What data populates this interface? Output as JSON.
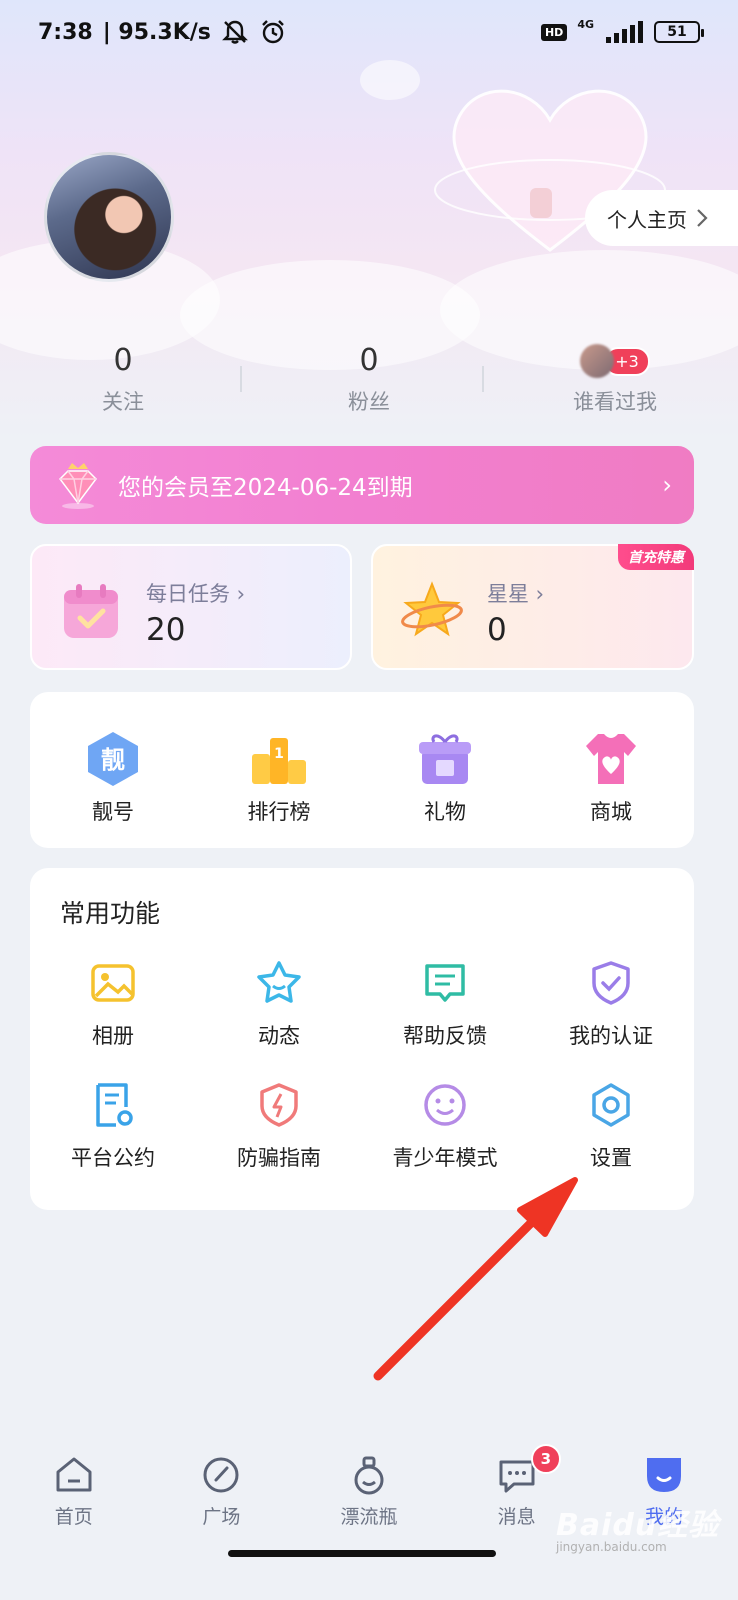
{
  "status_bar": {
    "time": "7:38",
    "speed": "| 95.3K/s",
    "network": "4G",
    "hd": "HD",
    "battery": "51"
  },
  "profile": {
    "homepage_label": "个人主页",
    "stats": [
      {
        "value": "0",
        "label": "关注"
      },
      {
        "value": "0",
        "label": "粉丝"
      },
      {
        "label": "谁看过我",
        "badge": "+3"
      }
    ]
  },
  "vip": {
    "text": "您的会员至2024-06-24到期"
  },
  "cards": {
    "task": {
      "title": "每日任务 ›",
      "value": "20"
    },
    "star": {
      "title": "星星 ›",
      "value": "0",
      "tag": "首充特惠"
    }
  },
  "quick": {
    "items": [
      {
        "label": "靓号",
        "icon": "pretty-number-icon"
      },
      {
        "label": "排行榜",
        "icon": "leaderboard-icon"
      },
      {
        "label": "礼物",
        "icon": "gift-icon"
      },
      {
        "label": "商城",
        "icon": "shop-icon"
      }
    ]
  },
  "common": {
    "title": "常用功能",
    "items": [
      {
        "label": "相册",
        "icon": "album-icon"
      },
      {
        "label": "动态",
        "icon": "moments-icon"
      },
      {
        "label": "帮助反馈",
        "icon": "feedback-icon"
      },
      {
        "label": "我的认证",
        "icon": "verify-icon"
      },
      {
        "label": "平台公约",
        "icon": "convention-icon"
      },
      {
        "label": "防骗指南",
        "icon": "anti-fraud-icon"
      },
      {
        "label": "青少年模式",
        "icon": "teen-mode-icon"
      },
      {
        "label": "设置",
        "icon": "settings-icon"
      }
    ]
  },
  "tabbar": {
    "items": [
      {
        "label": "首页",
        "icon": "home-icon"
      },
      {
        "label": "广场",
        "icon": "compass-icon"
      },
      {
        "label": "漂流瓶",
        "icon": "bottle-icon"
      },
      {
        "label": "消息",
        "icon": "message-icon",
        "badge": "3"
      },
      {
        "label": "我的",
        "icon": "me-icon"
      }
    ]
  },
  "watermark": {
    "text": "Baidu经验",
    "sub": "jingyan.baidu.com"
  },
  "colors": {
    "accent": "#4f6df0",
    "vip_gradient": "#f27fd0",
    "badge": "#f0405a",
    "arrow": "#ee3424"
  }
}
